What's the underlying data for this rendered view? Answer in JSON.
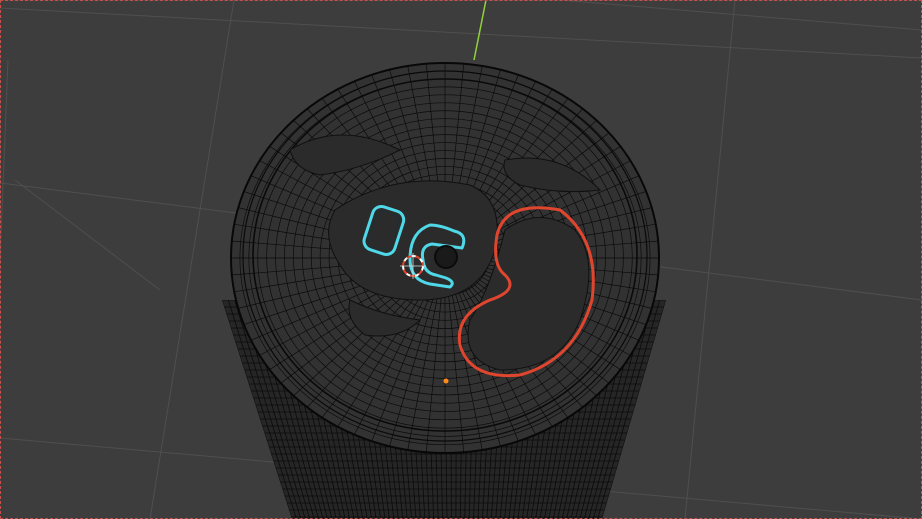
{
  "viewport": {
    "mode": "wireframe",
    "background": "#3d3d3d",
    "grid_color": "#4f4f4f",
    "axis_y_color": "#8fd13b",
    "wire_color": "#0b0b0b",
    "border_color": "#c8504a"
  },
  "object": {
    "shape": "can-body-with-lid",
    "selection_active_color": "#4fd8e8",
    "selection_secondary_color": "#e0452e",
    "origin_color": "#ff8a1a",
    "cursor_colors": [
      "#ffffff",
      "#e0452e"
    ]
  }
}
